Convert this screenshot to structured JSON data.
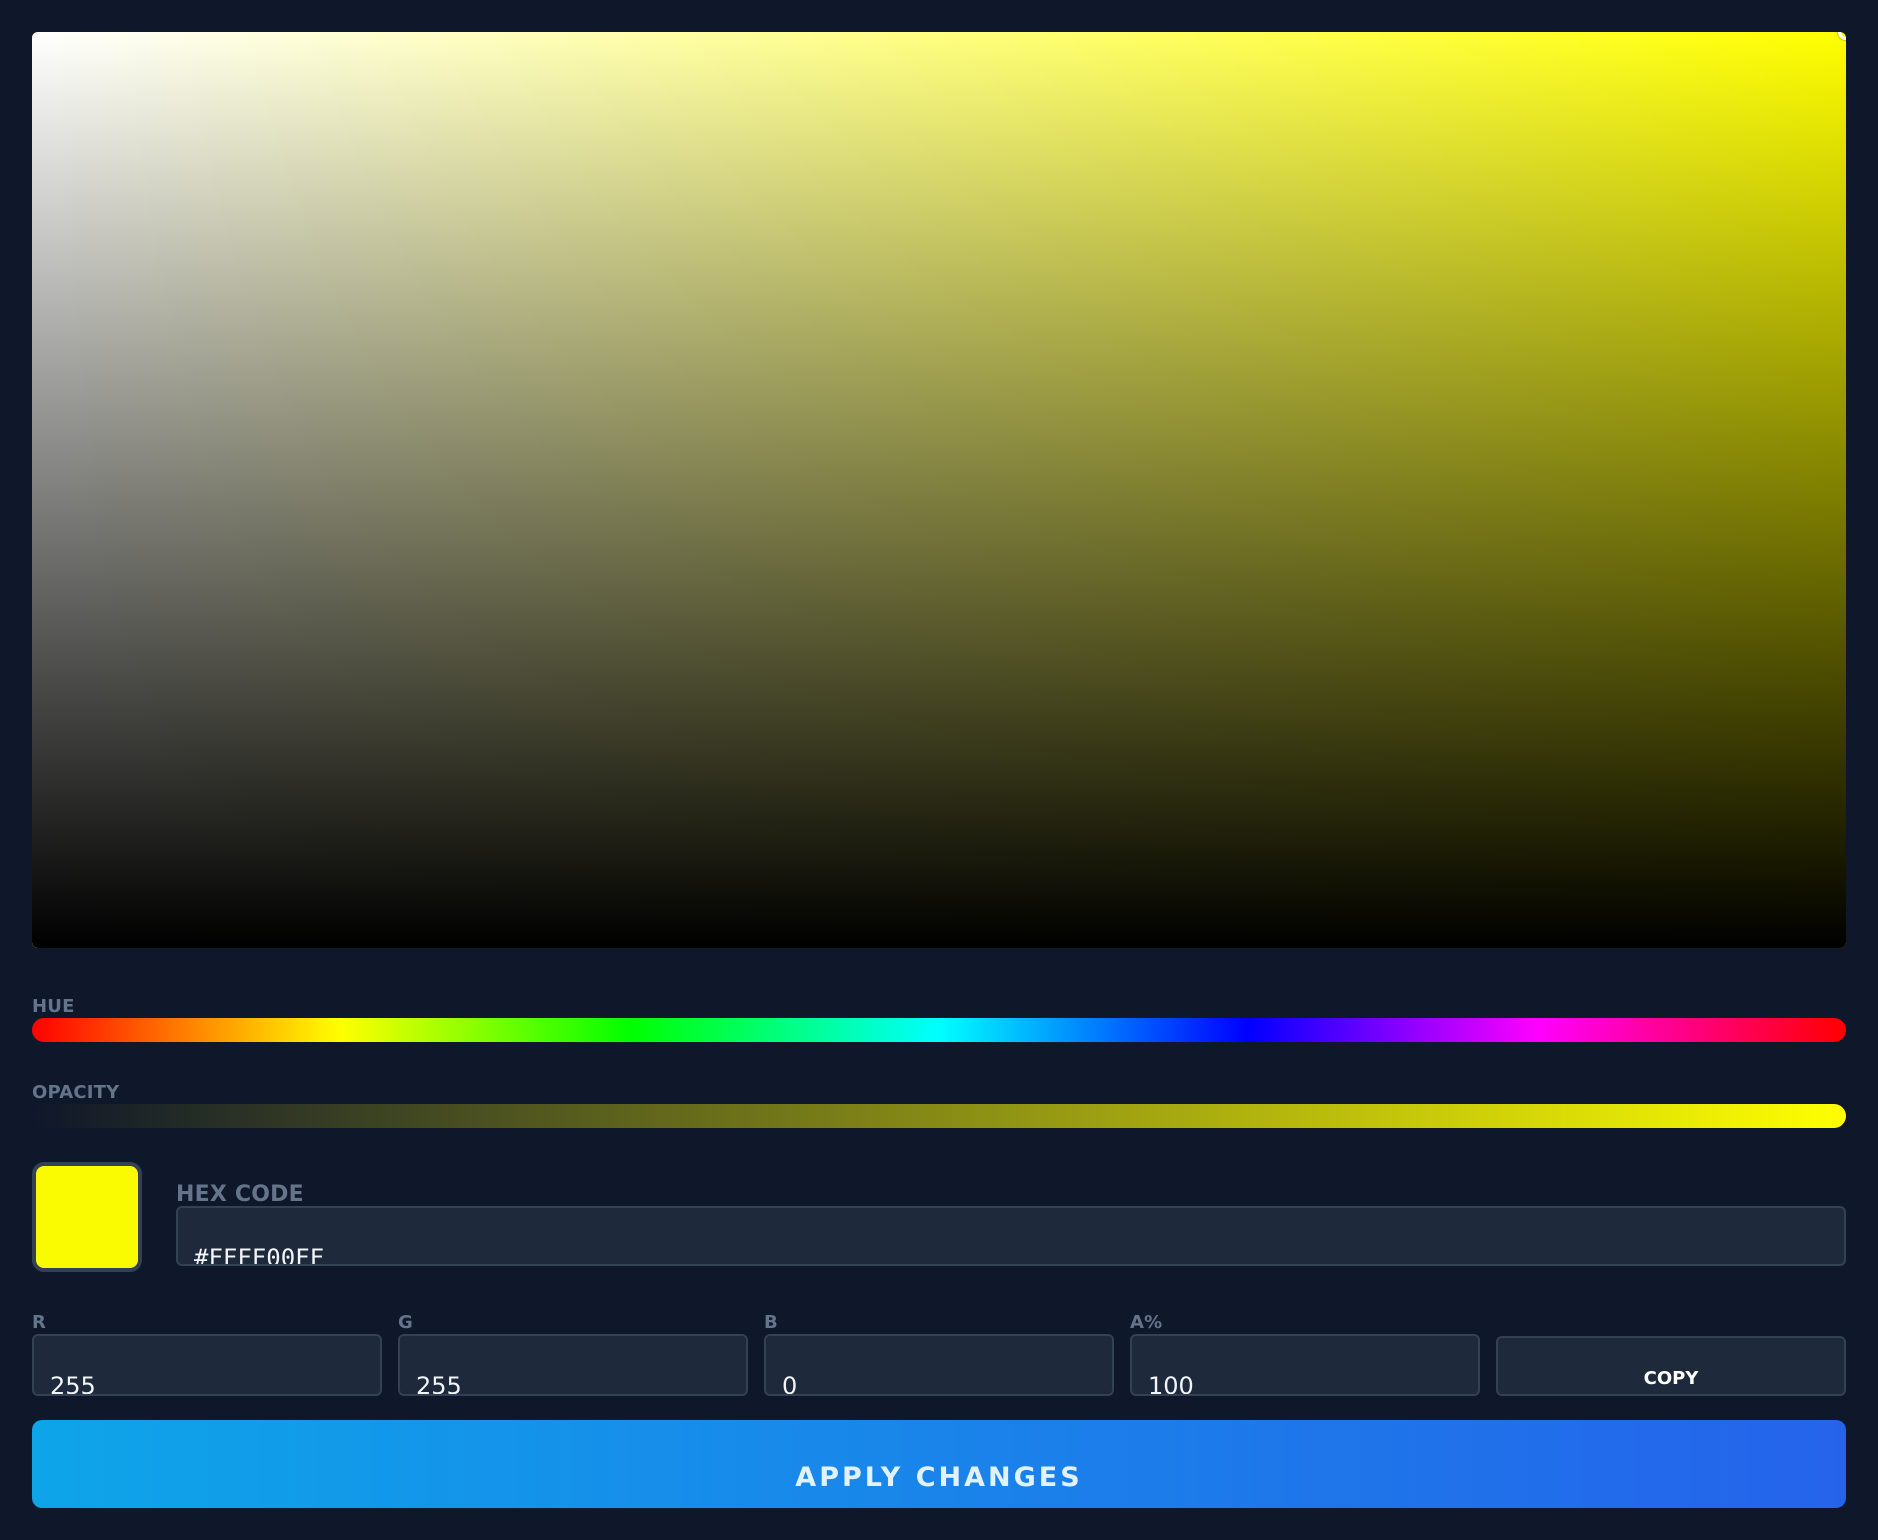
{
  "picker": {
    "hue_label": "HUE",
    "opacity_label": "OPACITY",
    "current_color": "#fafa00",
    "hue_degrees": 60,
    "saturation": 1.0,
    "brightness": 1.0,
    "opacity_fraction": 1.0
  },
  "hex": {
    "label": "HEX CODE",
    "value": "#FFFF00FF"
  },
  "channels": [
    {
      "label": "R",
      "value": "255"
    },
    {
      "label": "G",
      "value": "255"
    },
    {
      "label": "B",
      "value": "0"
    },
    {
      "label": "A%",
      "value": "100"
    }
  ],
  "buttons": {
    "copy_label": "COPY",
    "apply_label": "APPLY CHANGES"
  },
  "colors": {
    "background": "#0f172a",
    "input_bg": "#1e293b",
    "input_border": "#334155",
    "label": "#64748b",
    "apply_gradient_start": "#0ea5e9",
    "apply_gradient_end": "#2563eb"
  }
}
